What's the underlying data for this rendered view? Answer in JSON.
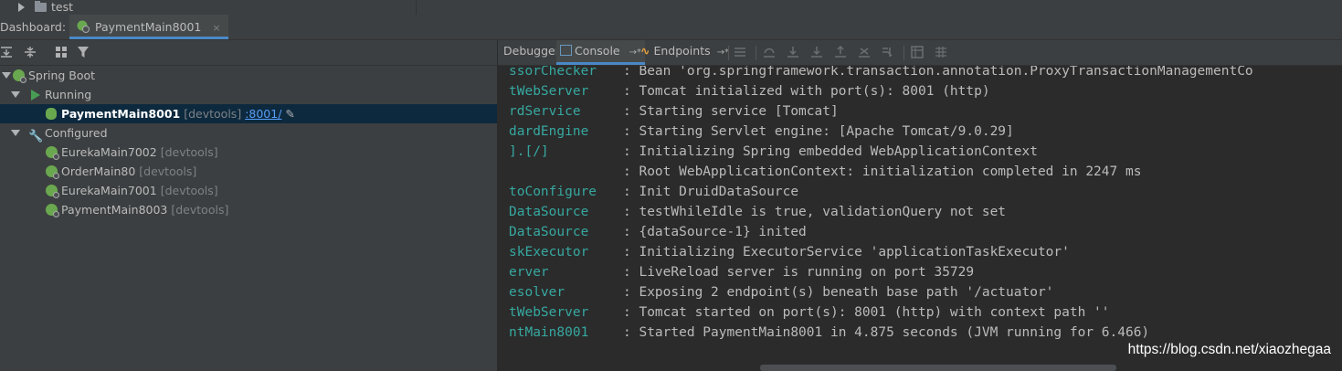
{
  "project_tree": {
    "folder_label": "test"
  },
  "dashboard": {
    "label": "Dashboard:",
    "tab_label": "PaymentMain8001",
    "close_glyph": "×"
  },
  "tree": {
    "spring_boot": "Spring Boot",
    "running": "Running",
    "running_app": {
      "name": "PaymentMain8001",
      "tag": "[devtools]",
      "port_link": ":8001/"
    },
    "configured": "Configured",
    "configured_apps": [
      {
        "name": "EurekaMain7002",
        "tag": "[devtools]"
      },
      {
        "name": "OrderMain80",
        "tag": "[devtools]"
      },
      {
        "name": "EurekaMain7001",
        "tag": "[devtools]"
      },
      {
        "name": "PaymentMain8003",
        "tag": "[devtools]"
      }
    ]
  },
  "right_tabs": {
    "debugger": "Debugger",
    "console": "Console",
    "console_pin": "→*",
    "endpoints": "Endpoints",
    "endpoints_pin": "→*"
  },
  "console_lines": [
    {
      "src": "ssorChecker",
      "msg": ": Bean 'org.springframework.transaction.annotation.ProxyTransactionManagementCo"
    },
    {
      "src": "tWebServer",
      "msg": ": Tomcat initialized with port(s): 8001 (http)"
    },
    {
      "src": "rdService",
      "msg": ": Starting service [Tomcat]"
    },
    {
      "src": "dardEngine",
      "msg": ": Starting Servlet engine: [Apache Tomcat/9.0.29]"
    },
    {
      "src": "].[/]",
      "msg": ": Initializing Spring embedded WebApplicationContext"
    },
    {
      "src": "",
      "msg": ": Root WebApplicationContext: initialization completed in 2247 ms"
    },
    {
      "src": "toConfigure",
      "msg": ": Init DruidDataSource"
    },
    {
      "src": "DataSource",
      "msg": ": testWhileIdle is true, validationQuery not set"
    },
    {
      "src": "DataSource",
      "msg": ": {dataSource-1} inited"
    },
    {
      "src": "skExecutor",
      "msg": ": Initializing ExecutorService 'applicationTaskExecutor'"
    },
    {
      "src": "erver",
      "msg": ": LiveReload server is running on port 35729"
    },
    {
      "src": "esolver",
      "msg": ": Exposing 2 endpoint(s) beneath base path '/actuator'"
    },
    {
      "src": "tWebServer",
      "msg": ": Tomcat started on port(s): 8001 (http) with context path ''"
    },
    {
      "src": "ntMain8001",
      "msg": ": Started PaymentMain8001 in 4.875 seconds (JVM running for 6.466)"
    }
  ],
  "watermark": "https://blog.csdn.net/xiaozhegaa",
  "colors": {
    "accent": "#4a88c7",
    "console_source": "#36a8a0",
    "link": "#589df6",
    "run_green": "#499c54"
  }
}
